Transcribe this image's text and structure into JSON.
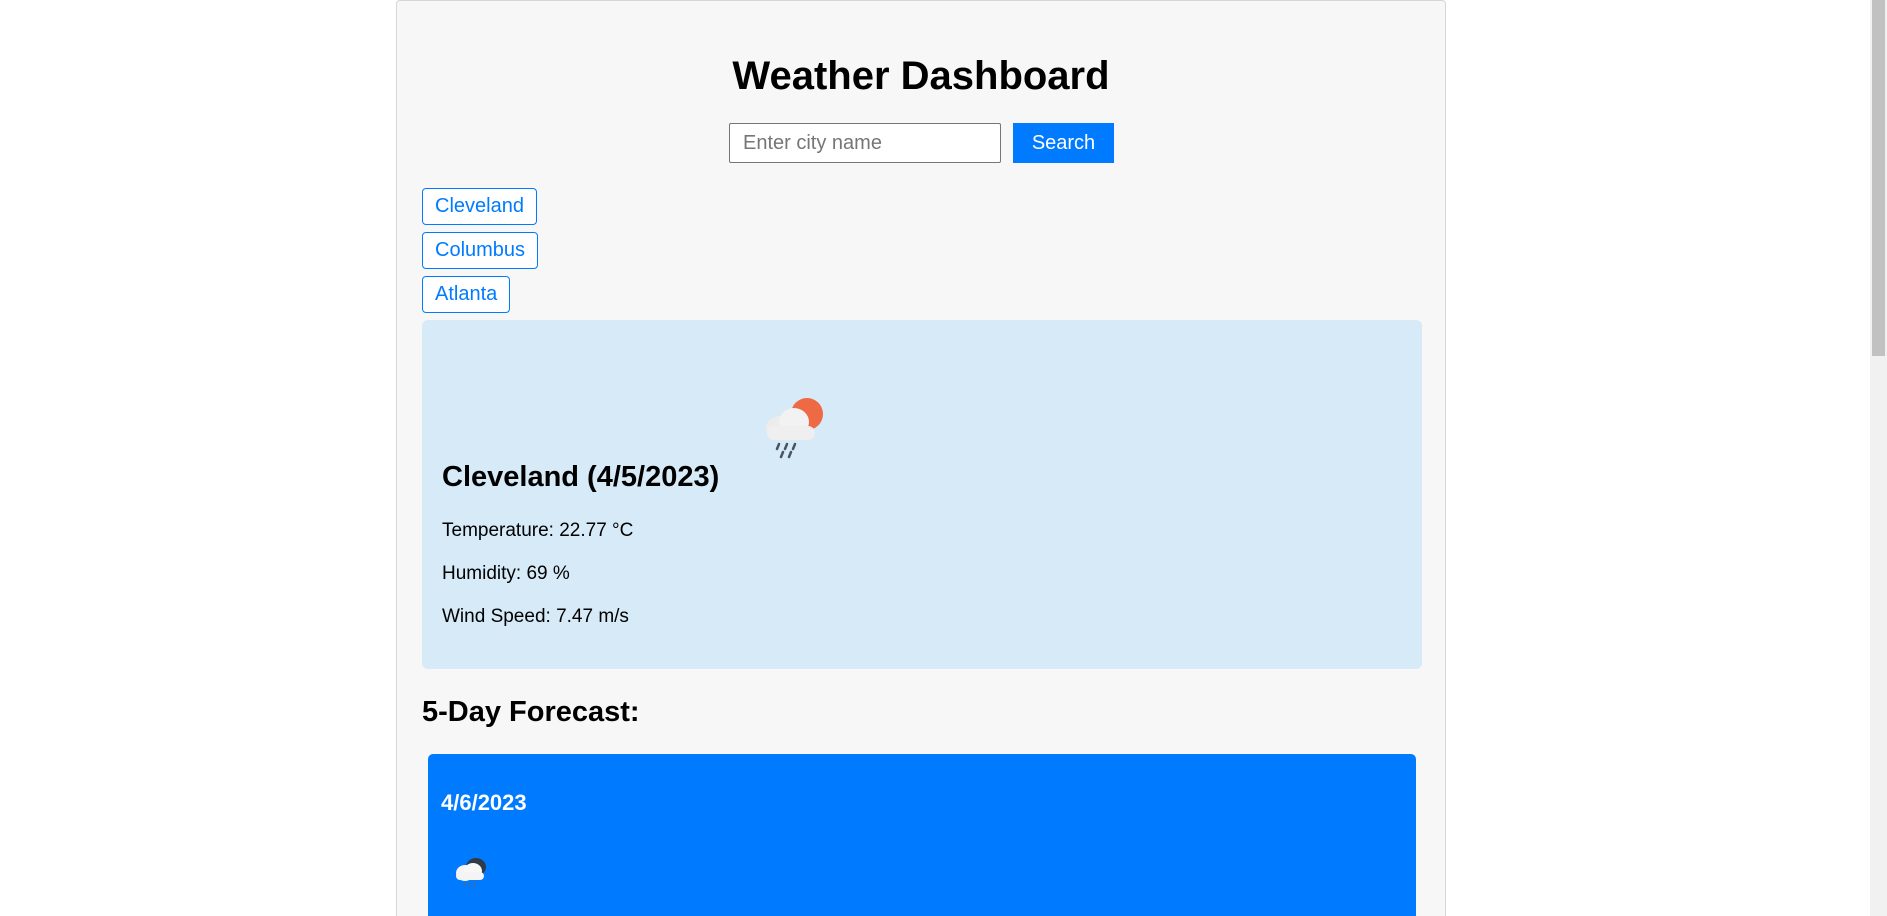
{
  "header": {
    "title": "Weather Dashboard"
  },
  "search": {
    "placeholder": "Enter city name",
    "value": "",
    "button_label": "Search"
  },
  "history": {
    "cities": [
      "Cleveland",
      "Columbus",
      "Atlanta"
    ]
  },
  "current": {
    "heading": "Cleveland (4/5/2023)",
    "icon": "rain-cloud-sun-icon",
    "temperature": "Temperature: 22.77 °C",
    "humidity": "Humidity: 69 %",
    "wind": "Wind Speed: 7.47 m/s"
  },
  "forecast": {
    "title": "5-Day Forecast:",
    "cards": [
      {
        "date": "4/6/2023",
        "icon": "rain-cloud-icon"
      }
    ]
  },
  "colors": {
    "accent": "#007bff",
    "current_background": "#d6eaf8",
    "page_panel": "#f7f7f7"
  }
}
